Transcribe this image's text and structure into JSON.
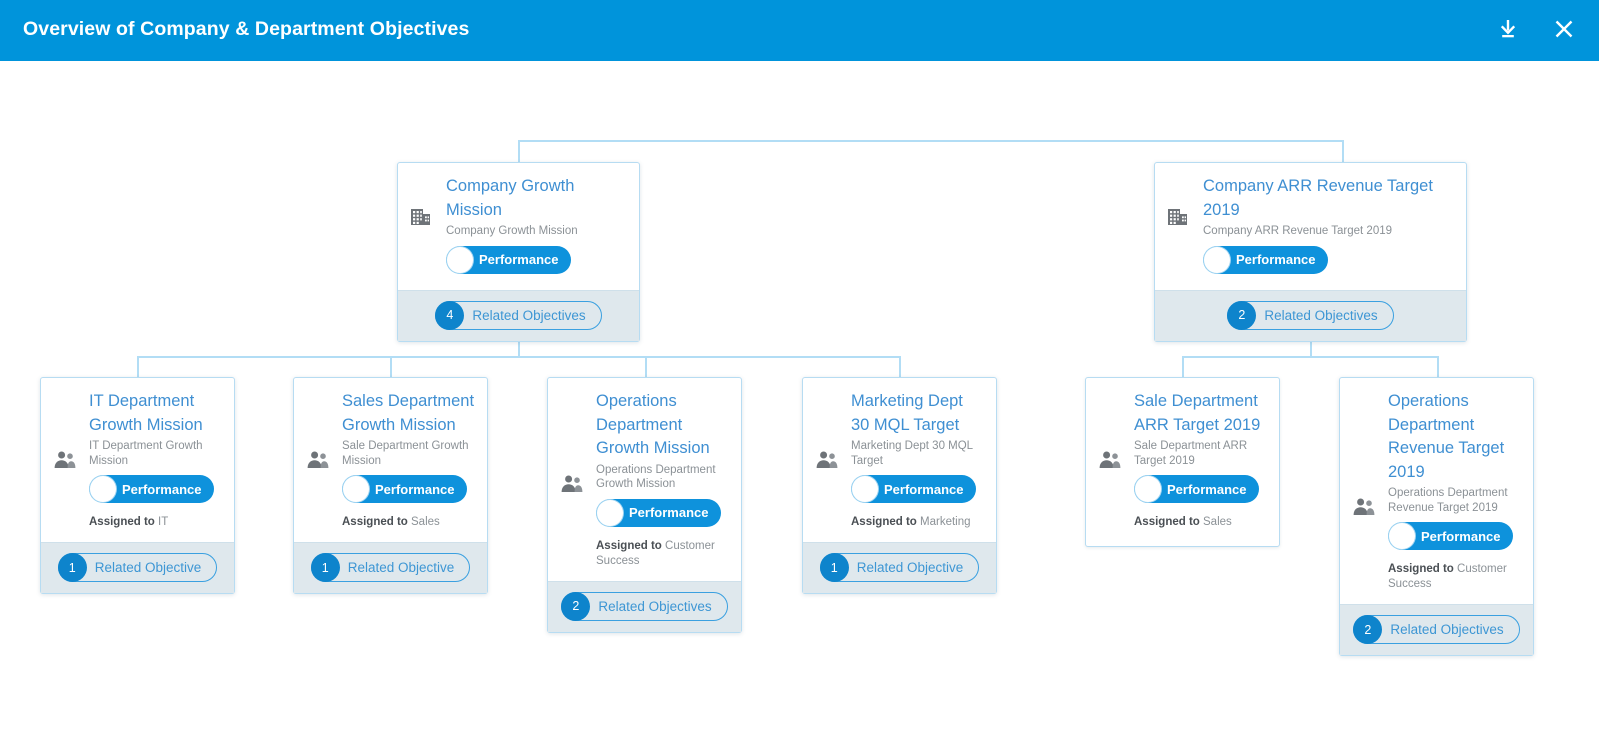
{
  "header": {
    "title": "Overview of Company & Department Objectives",
    "background_color": "#0094db",
    "download_icon": "download-icon",
    "close_icon": "close-icon"
  },
  "theme": {
    "accent": "#0094db",
    "title_link": "#3f8fd2",
    "muted_text": "#8b9196",
    "footer_bg": "#dfe8ed",
    "connector": "#b2ddf5",
    "toggle_on": "#0e92dc"
  },
  "labels": {
    "assigned_prefix": "Assigned to",
    "performance": "Performance"
  },
  "cards": [
    {
      "id": "company-growth-mission",
      "title": "Company Growth Mission",
      "subtitle": "Company Growth Mission",
      "icon": "building-icon",
      "toggle_label": "Performance",
      "assigned_prefix": "",
      "assigned_to": "",
      "related_count": "4",
      "related_label": "Related Objectives",
      "level": "company"
    },
    {
      "id": "company-arr-revenue-target-2019",
      "title": "Company ARR Revenue Target 2019",
      "subtitle": "Company ARR Revenue Target 2019",
      "icon": "building-icon",
      "toggle_label": "Performance",
      "assigned_prefix": "",
      "assigned_to": "",
      "related_count": "2",
      "related_label": "Related Objectives",
      "level": "company"
    },
    {
      "id": "it-department-growth-mission",
      "title": "IT Department Growth Mission",
      "subtitle": "IT Department Growth Mission",
      "icon": "people-icon",
      "toggle_label": "Performance",
      "assigned_prefix": "Assigned to",
      "assigned_to": "IT",
      "related_count": "1",
      "related_label": "Related Objective",
      "level": "department"
    },
    {
      "id": "sales-department-growth-mission",
      "title": "Sales Department Growth Mission",
      "subtitle": "Sale Department Growth Mission",
      "icon": "people-icon",
      "toggle_label": "Performance",
      "assigned_prefix": "Assigned to",
      "assigned_to": "Sales",
      "related_count": "1",
      "related_label": "Related Objective",
      "level": "department"
    },
    {
      "id": "operations-department-growth-mission",
      "title": "Operations Department Growth Mission",
      "subtitle": "Operations Department Growth Mission",
      "icon": "people-icon",
      "toggle_label": "Performance",
      "assigned_prefix": "Assigned to",
      "assigned_to": "Customer Success",
      "related_count": "2",
      "related_label": "Related Objectives",
      "level": "department"
    },
    {
      "id": "marketing-dept-30-mql-target",
      "title": "Marketing Dept 30 MQL Target",
      "subtitle": "Marketing Dept 30 MQL Target",
      "icon": "people-icon",
      "toggle_label": "Performance",
      "assigned_prefix": "Assigned to",
      "assigned_to": "Marketing",
      "related_count": "1",
      "related_label": "Related Objective",
      "level": "department"
    },
    {
      "id": "sale-department-arr-target-2019",
      "title": "Sale Department ARR Target 2019",
      "subtitle": "Sale Department ARR Target 2019",
      "icon": "people-icon",
      "toggle_label": "Performance",
      "assigned_prefix": "Assigned to",
      "assigned_to": "Sales",
      "related_count": "",
      "related_label": "",
      "level": "department"
    },
    {
      "id": "operations-department-revenue-target-2019",
      "title": "Operations Department Revenue Target 2019",
      "subtitle": "Operations Department Revenue Target 2019",
      "icon": "people-icon",
      "toggle_label": "Performance",
      "assigned_prefix": "Assigned to",
      "assigned_to": "Customer Success",
      "related_count": "2",
      "related_label": "Related Objectives",
      "level": "department"
    }
  ]
}
